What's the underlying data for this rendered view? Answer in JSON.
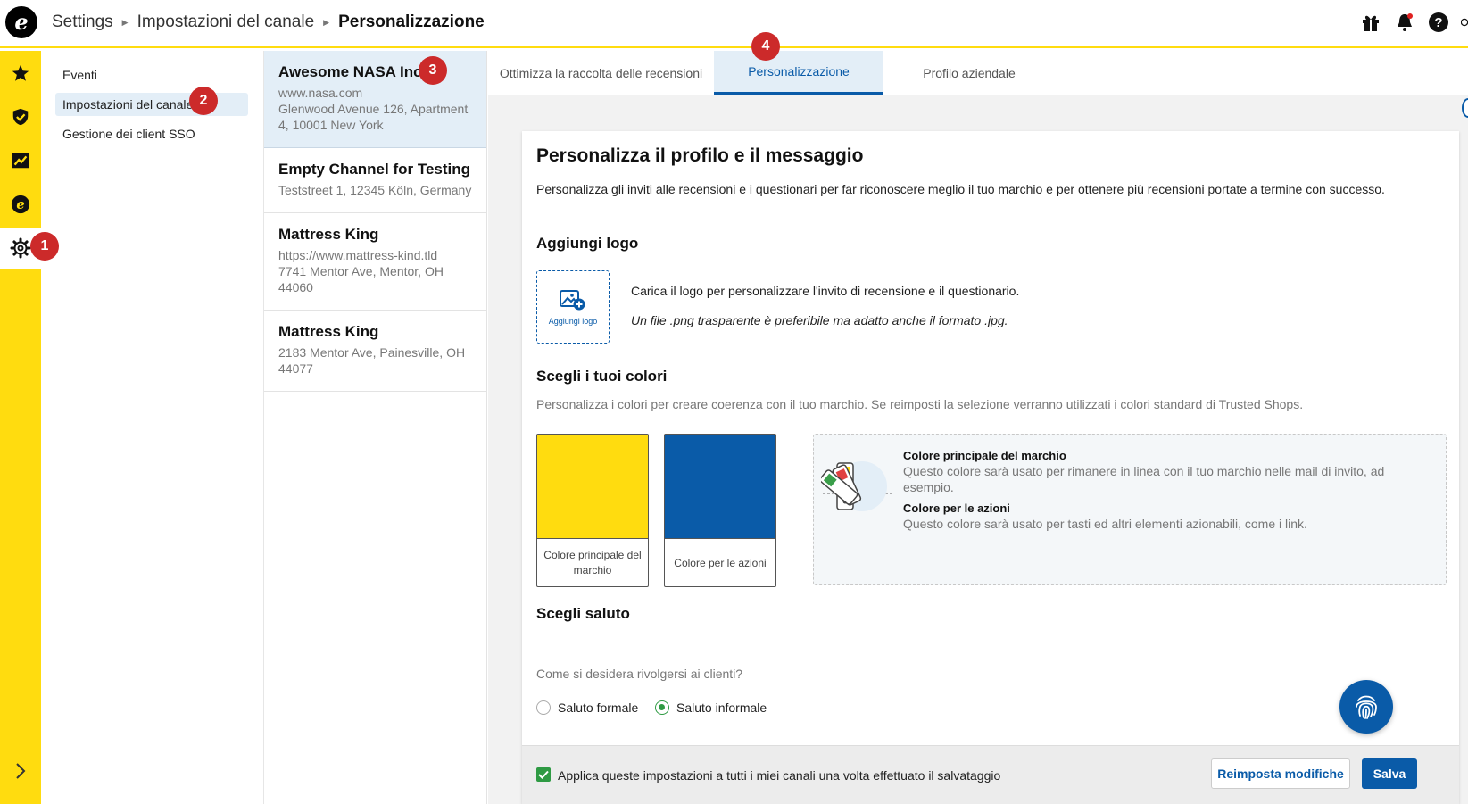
{
  "breadcrumb": [
    "Settings",
    "Impostazioni del canale",
    "Personalizzazione"
  ],
  "settings_nav": [
    {
      "label": "Eventi",
      "active": false
    },
    {
      "label": "Impostazioni del canale",
      "active": true
    },
    {
      "label": "Gestione dei client SSO",
      "active": false
    }
  ],
  "channels": [
    {
      "name": "Awesome NASA Inc.",
      "lines": [
        "www.nasa.com",
        "Glenwood Avenue 126, Apartment",
        "4, 10001 New York"
      ],
      "active": true
    },
    {
      "name": "Empty Channel for Testing",
      "lines": [
        "Teststreet 1, 12345 Köln, Germany"
      ],
      "active": false
    },
    {
      "name": "Mattress King",
      "lines": [
        "https://www.mattress-kind.tld",
        "7741 Mentor Ave, Mentor, OH",
        "44060"
      ],
      "active": false
    },
    {
      "name": "Mattress King",
      "lines": [
        "2183 Mentor Ave, Painesville, OH",
        "44077"
      ],
      "active": false
    }
  ],
  "tabs": [
    {
      "label": "Ottimizza la raccolta delle recensioni",
      "active": false
    },
    {
      "label": "Personalizzazione",
      "active": true
    },
    {
      "label": "Profilo aziendale",
      "active": false
    }
  ],
  "badges": [
    "1",
    "2",
    "3",
    "4"
  ],
  "card": {
    "title": "Personalizza il profilo e il messaggio",
    "intro": "Personalizza gli inviti alle recensioni e i questionari per far riconoscere meglio il tuo marchio e per ottenere più recensioni portate a termine con successo.",
    "logo_section": {
      "title": "Aggiungi logo",
      "button_label": "Aggiungi logo",
      "text": "Carica il logo per personalizzare l'invito di recensione e il questionario.",
      "hint": "Un file .png trasparente è preferibile ma adatto anche il formato .jpg."
    },
    "colors_section": {
      "title": "Scegli i tuoi colori",
      "description": "Personalizza i colori per creare coerenza con il tuo marchio. Se reimposti la selezione verranno utilizzati i colori standard di Trusted Shops.",
      "swatches": [
        {
          "label": "Colore principale del marchio",
          "color": "#ffdc0f"
        },
        {
          "label": "Colore per le azioni",
          "color": "#0a5ba8"
        }
      ],
      "info": [
        {
          "heading": "Colore principale del marchio",
          "text": "Questo colore sarà usato per rimanere in linea con il tuo marchio nelle mail di invito, ad esempio."
        },
        {
          "heading": "Colore per le azioni",
          "text": "Questo colore sarà usato per tasti ed altri elementi azionabili, come i link."
        }
      ]
    },
    "greeting_section": {
      "title": "Scegli saluto",
      "question": "Come si desidera rivolgersi ai clienti?",
      "options": [
        {
          "label": "Saluto formale",
          "checked": false
        },
        {
          "label": "Saluto informale",
          "checked": true
        }
      ]
    },
    "footer": {
      "apply_all_label": "Applica queste impostazioni a tutti i miei canali una volta effettuato il salvataggio",
      "apply_all_checked": true,
      "reset_label": "Reimposta modifiche",
      "save_label": "Salva"
    }
  },
  "colors": {
    "brand_yellow": "#ffdc0f",
    "action_blue": "#0a5ba8",
    "badge_red": "#cc2a2a",
    "check_green": "#2e9a43"
  },
  "icons": [
    "etrusted-logo",
    "gift-icon",
    "bell-icon",
    "help-icon",
    "star-icon",
    "shield-check-icon",
    "chart-icon",
    "e-icon",
    "gear-icon",
    "chevron-right-icon",
    "image-plus-icon",
    "color-palette-icon",
    "fingerprint-icon"
  ]
}
